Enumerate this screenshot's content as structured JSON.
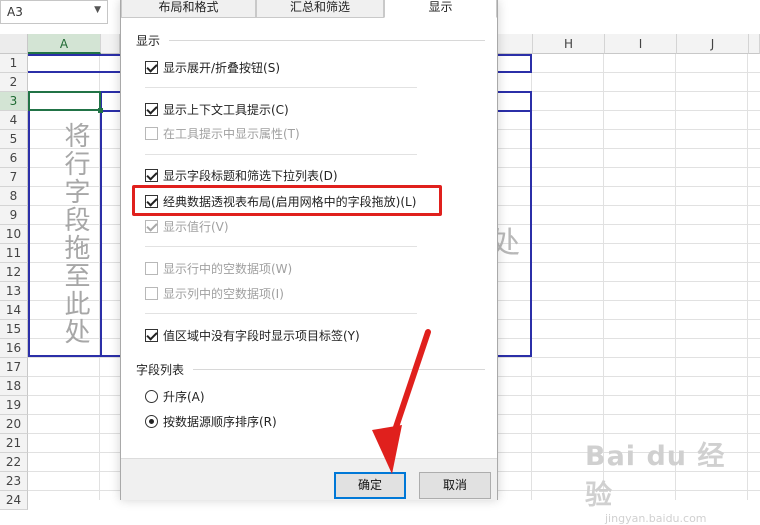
{
  "spreadsheet": {
    "name_box": "A3",
    "columns": [
      "A",
      "H",
      "I",
      "J"
    ],
    "rows": [
      "1",
      "2",
      "3",
      "4",
      "5",
      "6",
      "7",
      "8",
      "9",
      "10",
      "11",
      "12",
      "13",
      "14",
      "15",
      "16",
      "17",
      "18",
      "19",
      "20",
      "21",
      "22",
      "23",
      "24"
    ],
    "pivot_hint_vertical": "将行字段拖至此处",
    "pivot_hint_partial": "处"
  },
  "dialog": {
    "tabs": [
      "布局和格式",
      "汇总和筛选",
      "显示"
    ],
    "active_tab": "显示",
    "section_display": "显示",
    "options": [
      {
        "label": "显示展开/折叠按钮(S)",
        "checked": true,
        "disabled": false
      },
      {
        "label": "显示上下文工具提示(C)",
        "checked": true,
        "disabled": false
      },
      {
        "label": "在工具提示中显示属性(T)",
        "checked": false,
        "disabled": true
      },
      {
        "label": "显示字段标题和筛选下拉列表(D)",
        "checked": true,
        "disabled": false
      },
      {
        "label": "经典数据透视表布局(启用网格中的字段拖放)(L)",
        "checked": true,
        "disabled": false
      },
      {
        "label": "显示值行(V)",
        "checked": true,
        "disabled": true
      },
      {
        "label": "显示行中的空数据项(W)",
        "checked": false,
        "disabled": true
      },
      {
        "label": "显示列中的空数据项(I)",
        "checked": false,
        "disabled": true
      },
      {
        "label": "值区域中没有字段时显示项目标签(Y)",
        "checked": true,
        "disabled": false
      }
    ],
    "section_field_list": "字段列表",
    "sort_options": [
      {
        "label": "升序(A)",
        "selected": false
      },
      {
        "label": "按数据源顺序排序(R)",
        "selected": true
      }
    ],
    "ok_label": "确定",
    "cancel_label": "取消"
  },
  "annotation": {
    "highlight_color": "#e0201d",
    "arrow_color": "#e0201d"
  },
  "watermark": {
    "logo": "Bai du 经验",
    "url": "jingyan.baidu.com"
  }
}
